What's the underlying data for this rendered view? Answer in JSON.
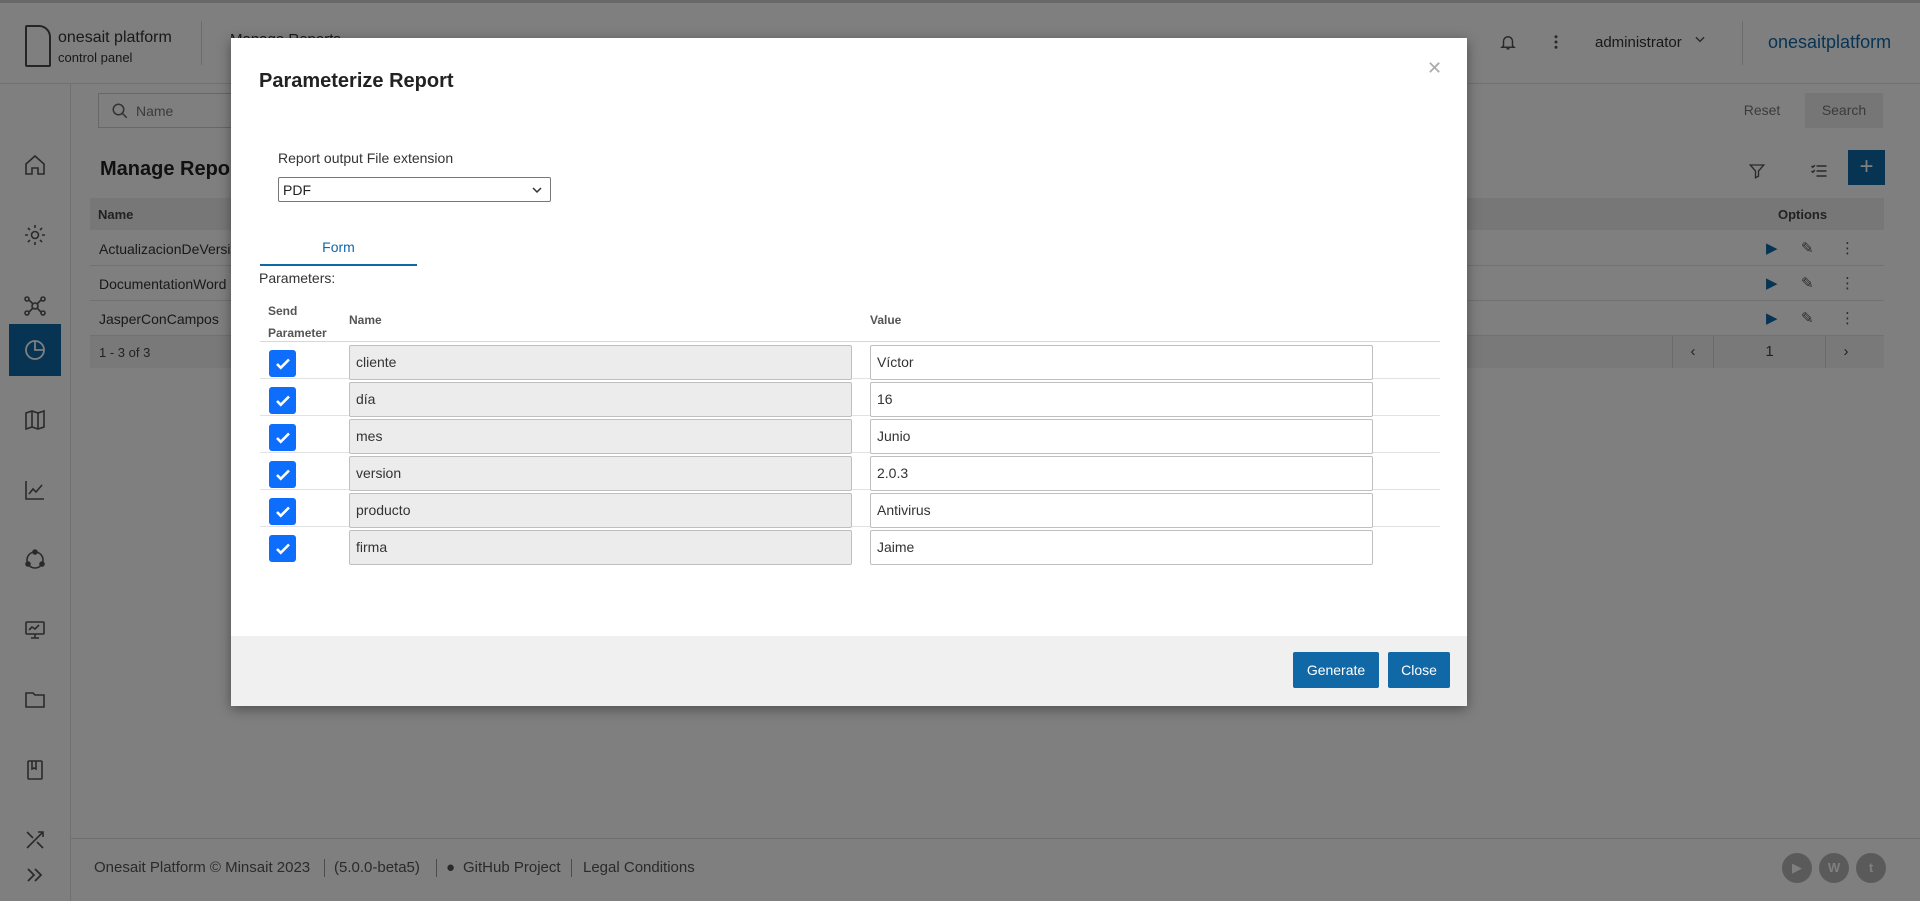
{
  "header": {
    "brand_title": "onesait platform",
    "brand_subtitle": "control panel",
    "page_crumb": "Manage Reports",
    "user": "administrator",
    "brand_right": "onesaitplatform"
  },
  "sidebar": {
    "items": [
      {
        "icon": "home-icon"
      },
      {
        "icon": "gear-icon"
      },
      {
        "icon": "network-icon"
      },
      {
        "icon": "analytics-icon",
        "active": true
      },
      {
        "icon": "map-icon"
      },
      {
        "icon": "chart-icon"
      },
      {
        "icon": "cycle-icon"
      },
      {
        "icon": "monitor-icon"
      },
      {
        "icon": "folder-icon"
      },
      {
        "icon": "book-icon"
      },
      {
        "icon": "tools-icon"
      },
      {
        "icon": "expand-icon"
      }
    ]
  },
  "toolbar": {
    "search_placeholder": "Name",
    "reset_label": "Reset",
    "search_label": "Search"
  },
  "main": {
    "title": "Manage Reports",
    "table": {
      "col_name": "Name",
      "col_options": "Options",
      "rows": [
        {
          "name": "ActualizacionDeVersion"
        },
        {
          "name": "DocumentationWord"
        },
        {
          "name": "JasperConCampos"
        }
      ],
      "count": "1 - 3 of 3",
      "page": "1"
    }
  },
  "footer": {
    "copyright": "Onesait Platform © Minsait 2023",
    "version": "(5.0.0-beta5)",
    "github": "GitHub Project",
    "legal": "Legal Conditions"
  },
  "modal": {
    "title": "Parameterize Report",
    "ext_label": "Report output File extension",
    "ext_value": "PDF",
    "tab_form": "Form",
    "params_label": "Parameters:",
    "col_send_1": "Send",
    "col_send_2": "Parameter",
    "col_name": "Name",
    "col_value": "Value",
    "params": [
      {
        "name": "cliente",
        "value": "Víctor",
        "send": true
      },
      {
        "name": "día",
        "value": "16",
        "send": true
      },
      {
        "name": "mes",
        "value": "Junio",
        "send": true
      },
      {
        "name": "version",
        "value": "2.0.3",
        "send": true
      },
      {
        "name": "producto",
        "value": "Antivirus",
        "send": true
      },
      {
        "name": "firma",
        "value": "Jaime",
        "send": true
      }
    ],
    "generate_label": "Generate",
    "close_label": "Close"
  },
  "colors": {
    "accent": "#1168a7",
    "checkbox": "#0d6efd",
    "overlay": "rgba(0,0,0,0.5)"
  }
}
